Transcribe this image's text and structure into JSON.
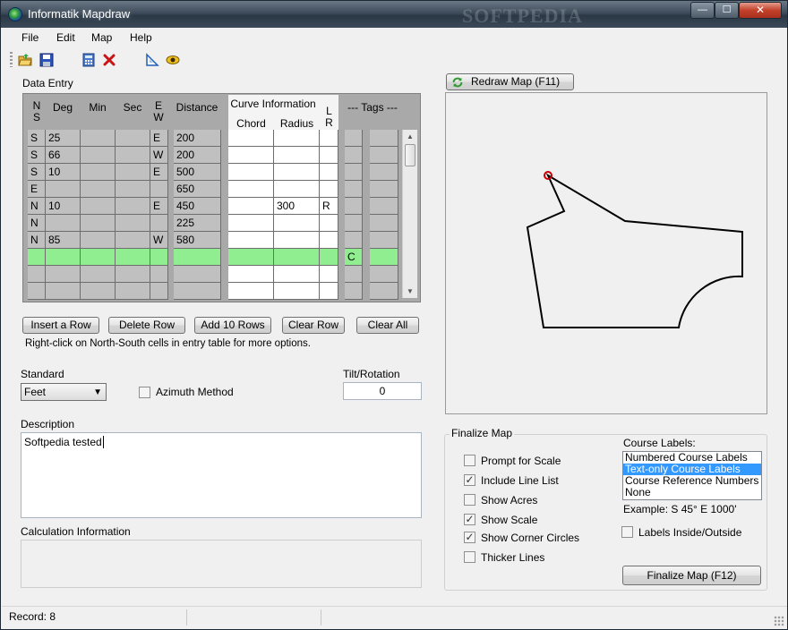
{
  "window": {
    "title": "Informatik Mapdraw",
    "watermark": "SOFTPEDIA",
    "min_glyph": "—",
    "max_glyph": "☐",
    "close_glyph": "✕"
  },
  "menu": [
    "File",
    "Edit",
    "Map",
    "Help"
  ],
  "toolbar_icons": [
    "open-folder-icon",
    "save-disk-icon",
    "calculator-icon",
    "delete-x-icon",
    "triangle-ruler-icon",
    "eye-icon"
  ],
  "data_entry": {
    "label": "Data Entry",
    "headers": {
      "ns": "N\nS",
      "deg": "Deg",
      "min": "Min",
      "sec": "Sec",
      "ew": "E\nW",
      "distance": "Distance",
      "curve_info": "Curve Information",
      "chord": "Chord",
      "radius": "Radius",
      "lr": "L\nR",
      "tags": "--- Tags ---"
    },
    "rows": [
      {
        "ns": "S",
        "deg": "25",
        "min": "",
        "sec": "",
        "ew": "E",
        "dist": "200",
        "chord": "",
        "radius": "",
        "lr": "",
        "tag1": "",
        "tag2": ""
      },
      {
        "ns": "S",
        "deg": "66",
        "min": "",
        "sec": "",
        "ew": "W",
        "dist": "200",
        "chord": "",
        "radius": "",
        "lr": "",
        "tag1": "",
        "tag2": ""
      },
      {
        "ns": "S",
        "deg": "10",
        "min": "",
        "sec": "",
        "ew": "E",
        "dist": "500",
        "chord": "",
        "radius": "",
        "lr": "",
        "tag1": "",
        "tag2": ""
      },
      {
        "ns": "E",
        "deg": "",
        "min": "",
        "sec": "",
        "ew": "",
        "dist": "650",
        "chord": "",
        "radius": "",
        "lr": "",
        "tag1": "",
        "tag2": ""
      },
      {
        "ns": "N",
        "deg": "10",
        "min": "",
        "sec": "",
        "ew": "E",
        "dist": "450",
        "chord": "",
        "radius": "300",
        "lr": "R",
        "tag1": "",
        "tag2": ""
      },
      {
        "ns": "N",
        "deg": "",
        "min": "",
        "sec": "",
        "ew": "",
        "dist": "225",
        "chord": "",
        "radius": "",
        "lr": "",
        "tag1": "",
        "tag2": ""
      },
      {
        "ns": "N",
        "deg": "85",
        "min": "",
        "sec": "",
        "ew": "W",
        "dist": "580",
        "chord": "",
        "radius": "",
        "lr": "",
        "tag1": "",
        "tag2": ""
      },
      {
        "ns": "",
        "deg": "",
        "min": "",
        "sec": "",
        "ew": "",
        "dist": "",
        "chord": "",
        "radius": "",
        "lr": "",
        "tag1": "C",
        "tag2": "",
        "highlight": true
      },
      {
        "ns": "",
        "deg": "",
        "min": "",
        "sec": "",
        "ew": "",
        "dist": "",
        "chord": "",
        "radius": "",
        "lr": "",
        "tag1": "",
        "tag2": ""
      },
      {
        "ns": "",
        "deg": "",
        "min": "",
        "sec": "",
        "ew": "",
        "dist": "",
        "chord": "",
        "radius": "",
        "lr": "",
        "tag1": "",
        "tag2": ""
      }
    ]
  },
  "buttons": {
    "insert_row": "Insert a Row",
    "delete_row": "Delete Row",
    "add_10_rows": "Add 10 Rows",
    "clear_row": "Clear Row",
    "clear_all": "Clear All",
    "redraw_map": "Redraw Map (F11)",
    "finalize_map": "Finalize Map (F12)"
  },
  "hint": "Right-click on North-South cells in entry table for more options.",
  "standard": {
    "label": "Standard",
    "value": "Feet"
  },
  "azimuth": {
    "label": "Azimuth Method",
    "checked": false
  },
  "tilt": {
    "label": "Tilt/Rotation",
    "value": "0"
  },
  "description": {
    "label": "Description",
    "value": "Softpedia tested"
  },
  "calc_info": {
    "label": "Calculation Information"
  },
  "finalize": {
    "label": "Finalize Map",
    "options": [
      {
        "label": "Prompt for Scale",
        "checked": false
      },
      {
        "label": "Include Line List",
        "checked": true
      },
      {
        "label": "Show Acres",
        "checked": false
      },
      {
        "label": "Show Scale",
        "checked": true
      },
      {
        "label": "Show Corner Circles",
        "checked": true
      },
      {
        "label": "Thicker Lines",
        "checked": false
      }
    ],
    "course_labels_title": "Course Labels:",
    "course_labels": [
      "Numbered Course Labels",
      "Text-only Course Labels",
      "Course Reference Numbers",
      "None"
    ],
    "selected_course_label": 1,
    "example": "Example: S 45° E 1000'",
    "labels_inside_outside": {
      "label": "Labels Inside/Outside",
      "checked": false
    }
  },
  "status": {
    "record": "Record: 8"
  },
  "colors": {
    "highlight_row": "#90ee90",
    "start_circle": "#cc0000",
    "selected_item": "#3399ff"
  }
}
